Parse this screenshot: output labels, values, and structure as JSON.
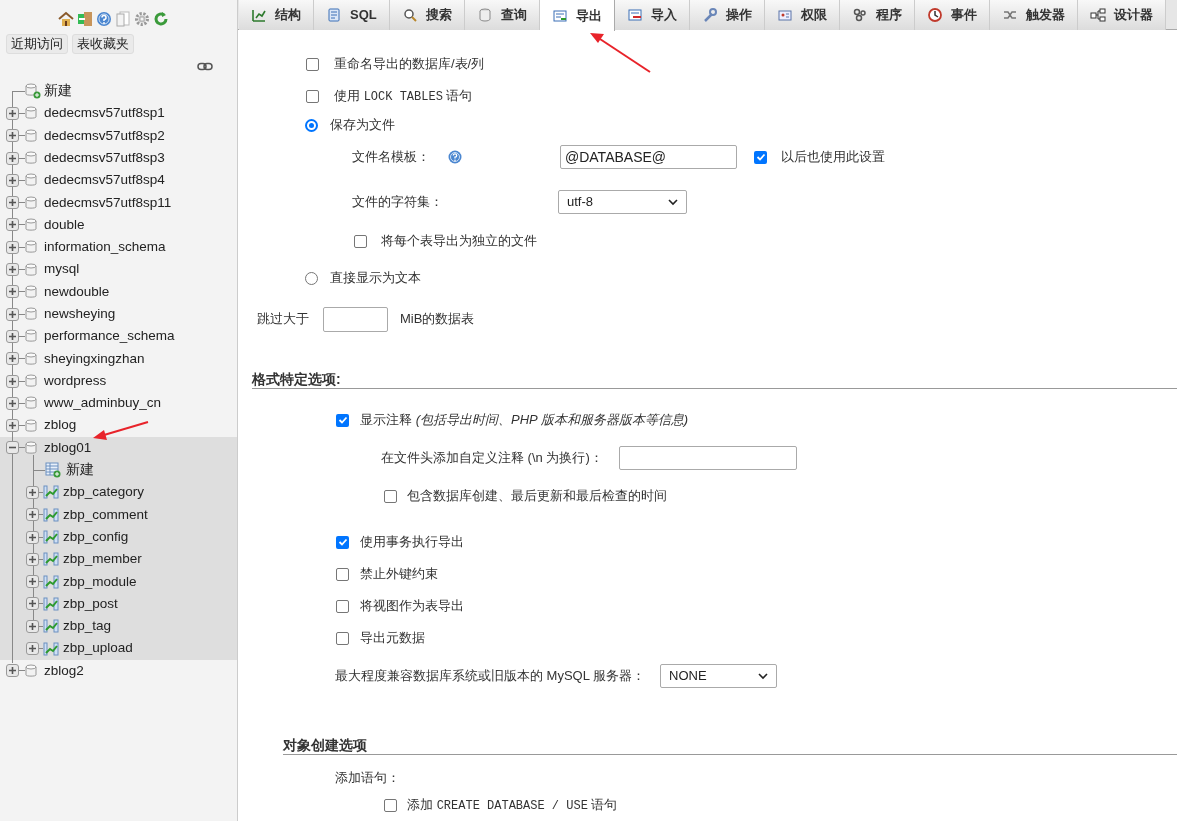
{
  "sidebar": {
    "quick_buttons": [
      "近期访问",
      "表收藏夹"
    ],
    "tree": [
      {
        "kind": "new",
        "label": "新建"
      },
      {
        "kind": "database",
        "label": "dedecmsv57utf8sp1",
        "expanded": false,
        "selected": false
      },
      {
        "kind": "database",
        "label": "dedecmsv57utf8sp2",
        "expanded": false,
        "selected": false
      },
      {
        "kind": "database",
        "label": "dedecmsv57utf8sp3",
        "expanded": false,
        "selected": false
      },
      {
        "kind": "database",
        "label": "dedecmsv57utf8sp4",
        "expanded": false,
        "selected": false
      },
      {
        "kind": "database",
        "label": "dedecmsv57utf8sp11",
        "expanded": false,
        "selected": false
      },
      {
        "kind": "database",
        "label": "double",
        "expanded": false,
        "selected": false
      },
      {
        "kind": "database",
        "label": "information_schema",
        "expanded": false,
        "selected": false
      },
      {
        "kind": "database",
        "label": "mysql",
        "expanded": false,
        "selected": false
      },
      {
        "kind": "database",
        "label": "newdouble",
        "expanded": false,
        "selected": false
      },
      {
        "kind": "database",
        "label": "newsheying",
        "expanded": false,
        "selected": false
      },
      {
        "kind": "database",
        "label": "performance_schema",
        "expanded": false,
        "selected": false
      },
      {
        "kind": "database",
        "label": "sheyingxingzhan",
        "expanded": false,
        "selected": false
      },
      {
        "kind": "database",
        "label": "wordpress",
        "expanded": false,
        "selected": false
      },
      {
        "kind": "database",
        "label": "www_adminbuy_cn",
        "expanded": false,
        "selected": false
      },
      {
        "kind": "database",
        "label": "zblog",
        "expanded": false,
        "selected": false
      },
      {
        "kind": "database",
        "label": "zblog01",
        "expanded": true,
        "selected": true,
        "children": [
          {
            "kind": "new",
            "label": "新建"
          },
          {
            "kind": "table",
            "label": "zbp_category",
            "expanded": false
          },
          {
            "kind": "table",
            "label": "zbp_comment",
            "expanded": false
          },
          {
            "kind": "table",
            "label": "zbp_config",
            "expanded": false
          },
          {
            "kind": "table",
            "label": "zbp_member",
            "expanded": false
          },
          {
            "kind": "table",
            "label": "zbp_module",
            "expanded": false
          },
          {
            "kind": "table",
            "label": "zbp_post",
            "expanded": false
          },
          {
            "kind": "table",
            "label": "zbp_tag",
            "expanded": false
          },
          {
            "kind": "table",
            "label": "zbp_upload",
            "expanded": false
          }
        ]
      },
      {
        "kind": "database",
        "label": "zblog2",
        "expanded": false,
        "selected": false
      }
    ]
  },
  "tabs": [
    {
      "label": "结构",
      "selected": false
    },
    {
      "label": "SQL",
      "selected": false
    },
    {
      "label": "搜索",
      "selected": false
    },
    {
      "label": "查询",
      "selected": false
    },
    {
      "label": "导出",
      "selected": true
    },
    {
      "label": "导入",
      "selected": false
    },
    {
      "label": "操作",
      "selected": false
    },
    {
      "label": "权限",
      "selected": false
    },
    {
      "label": "程序",
      "selected": false
    },
    {
      "label": "事件",
      "selected": false
    },
    {
      "label": "触发器",
      "selected": false
    },
    {
      "label": "设计器",
      "selected": false
    }
  ],
  "output": {
    "rename": {
      "label": "重命名导出的数据库/表/列",
      "checked": false
    },
    "lock_tables": {
      "label_before": "使用",
      "code": "LOCK TABLES",
      "label_after": "语句",
      "checked": false
    },
    "modes": [
      {
        "label": "保存为文件",
        "selected": true
      },
      {
        "label": "直接显示为文本",
        "selected": false
      }
    ],
    "filename_template": {
      "label": "文件名模板：",
      "value": "@DATABASE@",
      "remember": {
        "label": "以后也使用此设置",
        "checked": true
      }
    },
    "charset": {
      "label": "文件的字符集：",
      "value": "utf-8"
    },
    "separate_files": {
      "label": "将每个表导出为独立的文件",
      "checked": false
    },
    "skip_tables": {
      "label": "跳过大于",
      "unit": "MiB的数据表"
    }
  },
  "format_options": {
    "heading": "格式特定选项:",
    "comments": {
      "label": "显示注释 *(包括导出时间、PHP 版本和服务器版本等信息)*",
      "checked": true
    },
    "custom_comment": {
      "label": "在文件头添加自定义注释 (\\n 为换行)："
    },
    "include_times": {
      "label": "包含数据库创建、最后更新和最后检查的时间",
      "checked": false
    },
    "checks": [
      {
        "label": "使用事务执行导出",
        "checked": true
      },
      {
        "label": "禁止外键约束",
        "checked": false
      },
      {
        "label": "将视图作为表导出",
        "checked": false
      },
      {
        "label": "导出元数据",
        "checked": false
      }
    ],
    "compatibility": {
      "label": "最大程度兼容数据库系统或旧版本的 MySQL 服务器：",
      "value": "NONE"
    }
  },
  "object_options": {
    "heading": "对象创建选项",
    "statements_label": "添加语句：",
    "create_database": {
      "label_before": "添加",
      "code": "CREATE DATABASE / USE",
      "label_after": "语句",
      "checked": false
    }
  }
}
